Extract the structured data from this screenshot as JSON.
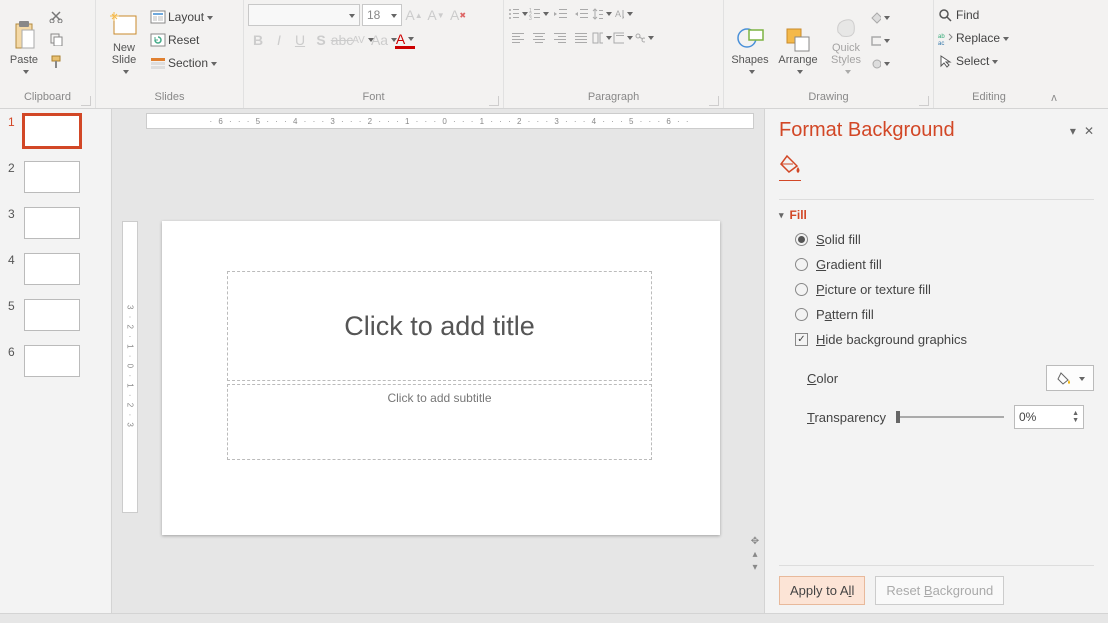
{
  "ribbon": {
    "clipboard": {
      "label": "Clipboard",
      "paste": "Paste"
    },
    "slides": {
      "label": "Slides",
      "newSlide": "New\nSlide",
      "layout": "Layout",
      "reset": "Reset",
      "section": "Section"
    },
    "font": {
      "label": "Font",
      "fontName": "",
      "fontSize": "18"
    },
    "paragraph": {
      "label": "Paragraph"
    },
    "drawing": {
      "label": "Drawing",
      "shapes": "Shapes",
      "arrange": "Arrange",
      "quick": "Quick\nStyles"
    },
    "editing": {
      "label": "Editing",
      "find": "Find",
      "replace": "Replace",
      "select": "Select"
    }
  },
  "thumbs": [
    1,
    2,
    3,
    4,
    5,
    6
  ],
  "activeThumb": 1,
  "rulerH": "· 6 · · · 5 · · · 4 · · · 3 · · · 2 · · · 1 · · · 0 · · · 1 · · · 2 · · · 3 · · · 4 · · · 5 · · · 6 · ·",
  "rulerV": "3 · 2 · 1 · 0 · 1 · 2 · 3",
  "slide": {
    "title": "Click to add title",
    "subtitle": "Click to add subtitle"
  },
  "pane": {
    "title": "Format Background",
    "section": "Fill",
    "solid": "Solid fill",
    "gradient": "Gradient fill",
    "picture": "Picture or texture fill",
    "pattern": "Pattern fill",
    "hide": "Hide background graphics",
    "color": "Color",
    "transparency": "Transparency",
    "transVal": "0%",
    "apply": "Apply to All",
    "reset": "Reset Background"
  }
}
